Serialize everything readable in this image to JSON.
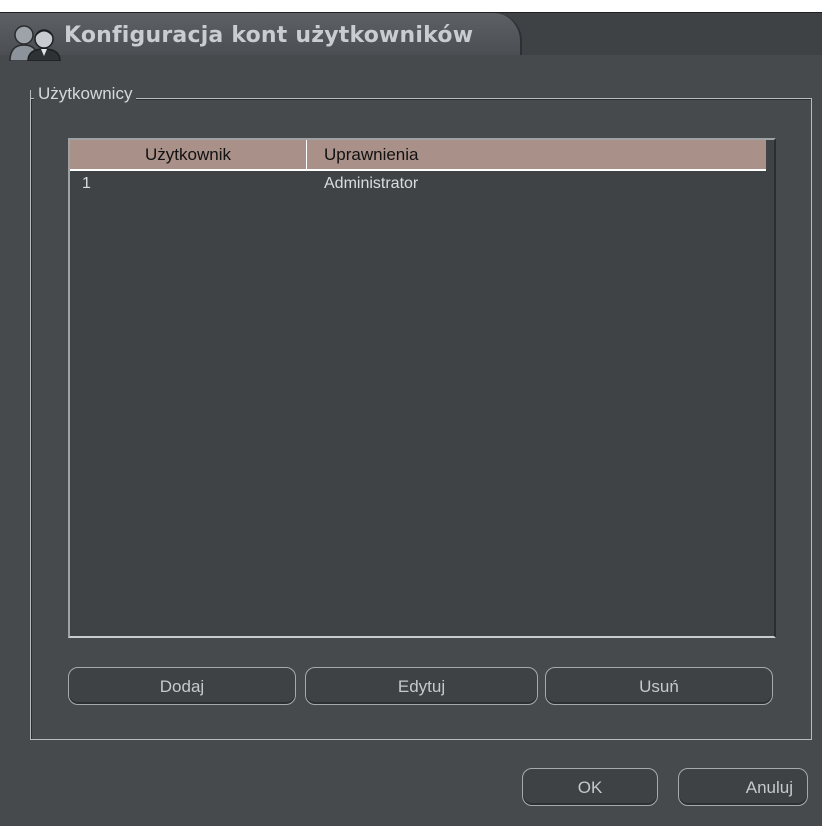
{
  "window": {
    "title": "Konfiguracja kont użytkowników",
    "title_icon": "users-icon"
  },
  "users_group": {
    "legend": "Użytkownicy",
    "columns": [
      "Użytkownik",
      "Uprawnienia"
    ],
    "rows": [
      {
        "user": "1",
        "permissions": "Administrator"
      }
    ],
    "buttons": {
      "add": "Dodaj",
      "edit": "Edytuj",
      "delete": "Usuń"
    }
  },
  "dialog_buttons": {
    "ok": "OK",
    "cancel": "Anuluj"
  },
  "colors": {
    "background": "#474a4d",
    "header": "#a99089",
    "text": "#dadcde"
  }
}
